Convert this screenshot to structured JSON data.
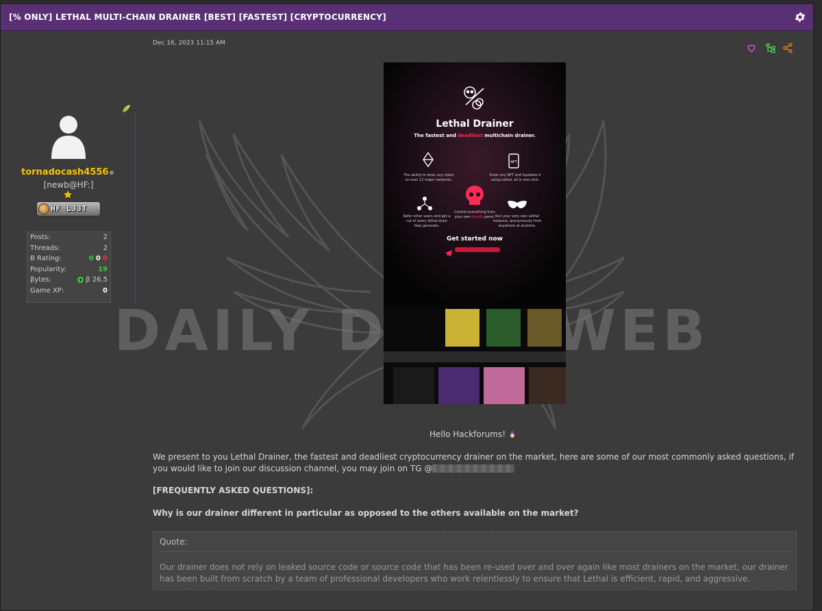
{
  "thread": {
    "title": "[% ONLY] LETHAL MULTI-CHAIN DRAINER [BEST] [FASTEST] [CRYPTOCURRENCY]",
    "settings_icon": "gear-icon"
  },
  "watermark": {
    "text": "DAILY DARK WEB"
  },
  "user": {
    "name": "tornadocash4556",
    "title": "[newb@HF:]",
    "badge_text": "HF L33T",
    "stats": [
      {
        "label": "Posts:",
        "value": "2"
      },
      {
        "label": "Threads:",
        "value": "2"
      },
      {
        "label": "B Rating:",
        "value": ""
      },
      {
        "label": "Popularity:",
        "value": "19"
      },
      {
        "label": "βytes:",
        "value": "β 26.5"
      },
      {
        "label": "Game XP:",
        "value": "0"
      }
    ],
    "b_rating": {
      "positive": "0",
      "neutral": "0",
      "negative": "0"
    }
  },
  "post": {
    "date": "Dec 16, 2023 11:15 AM",
    "actions": [
      "heart-icon",
      "tree-icon",
      "share-icon"
    ],
    "poster": {
      "title": "Lethal Drainer",
      "subtitle_pre": "The fastest and ",
      "subtitle_red": "deadliest",
      "subtitle_post": " multichain drainer.",
      "feature_1": "The ability to drain any token on over 12 major networks.",
      "feature_2": "Drain any NFT and liquidate it using Lethal, all in one click.",
      "feature_3": "Refer other users and get a cut of every lethal drain they generate.",
      "feature_4_pre": "Control everything from your own ",
      "feature_4_red": "deadly",
      "feature_4_post": " panel.",
      "feature_5": "Run your very own Lethal instance, anonymously from anywhere at anytime.",
      "cta": "Get started now"
    },
    "greeting": "Hello Hackforums!",
    "intro": "We present to you Lethal Drainer, the fastest and deadliest cryptocurrency drainer on the market, here are some of our most commonly asked questions, if you would like to join our discussion channel, you may join on TG @",
    "faq_heading": "[FREQUENTLY ASKED QUESTIONS]:",
    "faq_question": "Why is our drainer different in particular as opposed to the others available on the market?",
    "quote": {
      "label": "Quote:",
      "text": "Our drainer does not rely on leaked source code or source code that has been re-used over and over again like most drainers on the market, our drainer has been built from scratch by a team of professional developers who work relentlessly to ensure that Lethal is efficient, rapid, and aggressive."
    }
  },
  "colors": {
    "header": "#5a3075",
    "username": "#f5c400",
    "positive": "#3ec73e",
    "negative": "#e23c3c",
    "accent_red": "#ff2a55"
  }
}
